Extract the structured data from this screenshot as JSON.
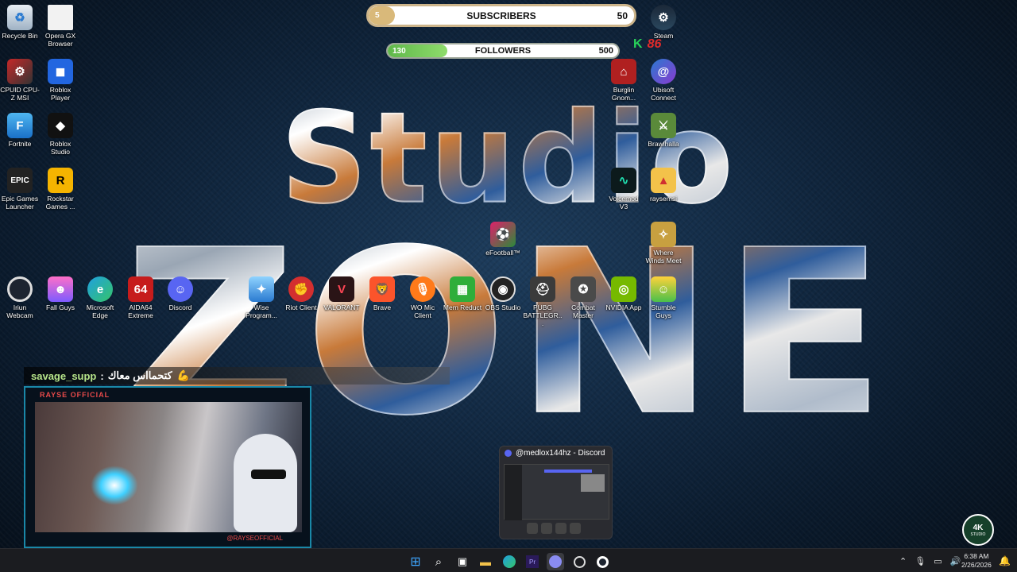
{
  "subscribers": {
    "title": "SUBSCRIBERS",
    "current": "5",
    "goal": "50",
    "progress": 0.1
  },
  "followers": {
    "title": "FOLLOWERS",
    "current": "130",
    "goal": "500",
    "progress": 0.26
  },
  "wallpaper": {
    "line1": "Studio",
    "line2": "ZONE"
  },
  "desktop_icons": {
    "recycle_bin": "Recycle Bin",
    "opera_gx": "Opera GX Browser",
    "cpuz": "CPUID CPU-Z MSI",
    "roblox_player": "Roblox Player",
    "fortnite": "Fortnite",
    "roblox_studio": "Roblox Studio",
    "epic": "Epic Games Launcher",
    "rockstar": "Rockstar Games ...",
    "iriun": "Iriun Webcam",
    "fall_guys": "Fall Guys",
    "edge": "Microsoft Edge",
    "aida64": "AIDA64 Extreme",
    "discord": "Discord",
    "wise": "Wise Program...",
    "riot": "Riot Client",
    "valorant": "VALORANT",
    "brave": "Brave",
    "wo_mic": "WO Mic Client",
    "mem_reduct": "Mem Reduct",
    "obs": "OBS Studio",
    "pubg": "PUBG BATTLEGR...",
    "combat_master": "Combat Master",
    "nvidia": "NVIDIA App",
    "stumble": "Stumble Guys",
    "steam": "Steam",
    "burglin": "Burglin Gnom...",
    "ubisoft": "Ubisoft Connect",
    "brawlhalla": "Brawlhalla",
    "voicemod": "Voicemod V3",
    "raysemsi": "raysemsi",
    "efootball": "eFootball™",
    "where_winds": "Where Winds Meet"
  },
  "overlay": {
    "k_badge": "K",
    "k_count": "86"
  },
  "chat": {
    "user": "savage_supp",
    "separator": ":",
    "message": "كتحمااس معاك",
    "emoji": "💪"
  },
  "cam": {
    "top_label": "RAYSE OFFICIAL",
    "bottom_label": "@RAYSEOFFICIAL"
  },
  "discord_preview": {
    "title": "@medlox144hz - Discord"
  },
  "tray": {
    "time": "6:38 AM",
    "date": "2/26/2026"
  },
  "watermark": {
    "line1": "4K",
    "line2": "STUDIO"
  },
  "colors": {
    "sub_accent": "#d9b97a",
    "follow_accent": "#6ec45a",
    "chat_name": "#b7e58a",
    "cam_border": "#1a88a8"
  }
}
